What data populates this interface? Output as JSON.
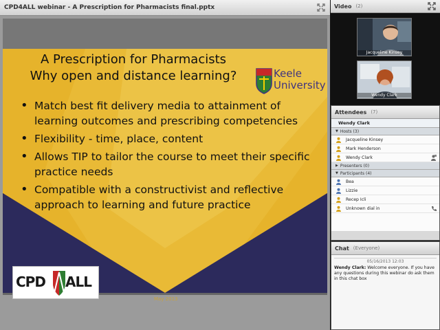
{
  "share_pod": {
    "title": "CPD4ALL webinar - A Prescription for Pharmacists final.pptx",
    "slide": {
      "title_line1": "A Prescription for Pharmacists",
      "title_line2": "Why open and distance learning?",
      "bullets": [
        "Match best fit delivery media to attainment of learning outcomes and prescribing competencies",
        "Flexibility - time, place, content",
        "Allows TIP to tailor the course to meet their specific practice needs",
        "Compatible with a constructivist and reflective approach to learning and future practice"
      ],
      "keele_line1": "Keele",
      "keele_line2": "University",
      "cpd_logo_left": "CPD",
      "cpd_logo_right": "ALL",
      "footer_date": "May 2013"
    },
    "colors": {
      "slide_yellow": "#e6b32b",
      "slide_navy": "#2c2a5c",
      "slide_light": "#f0cf63"
    }
  },
  "video_pod": {
    "title": "Video",
    "count": "(2)",
    "feeds": [
      {
        "name": "Jacqueline Kinsey"
      },
      {
        "name": "Wendy Clark"
      }
    ],
    "fullscreen_icon": "fullscreen-icon"
  },
  "attendees_pod": {
    "title": "Attendees",
    "count": "(7)",
    "current_user": "Wendy Clark",
    "hosts_label": "Hosts (3)",
    "hosts": [
      "Jacqueline Kinsey",
      "Mark Henderson",
      "Wendy Clark"
    ],
    "presenters_label": "Presenters (0)",
    "participants_label": "Participants (4)",
    "participants": [
      "Bea",
      "Lizzie",
      "Recep Icli",
      "Unknown dial in"
    ]
  },
  "chat_pod": {
    "title": "Chat",
    "scope": "(Everyone)",
    "timestamp": "05/16/2013 12:03",
    "sender": "Wendy Clark:",
    "message": "Welcome everyone. If you have any questions during this webinar do ask them in this chat box"
  }
}
